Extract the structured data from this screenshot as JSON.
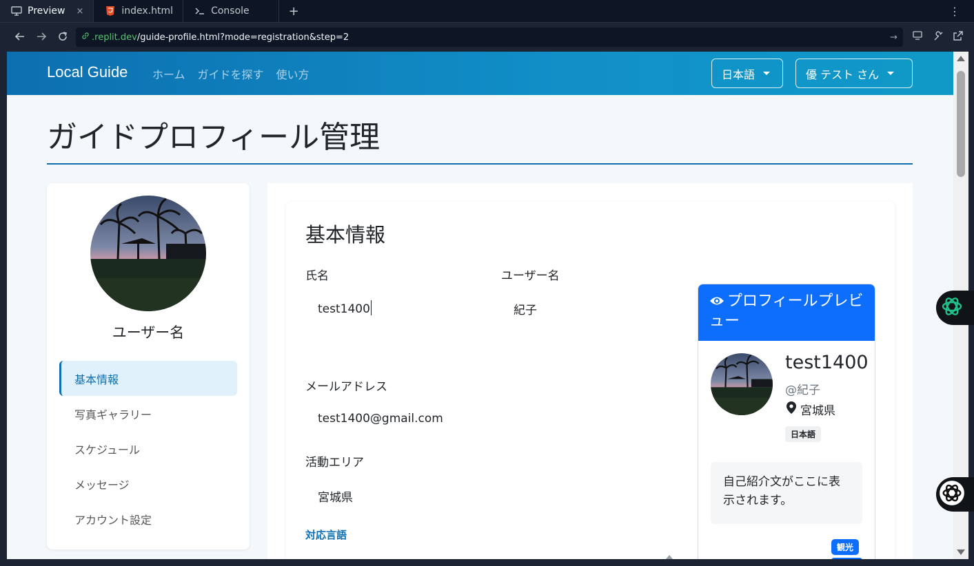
{
  "ide": {
    "tabs": [
      {
        "label": "Preview",
        "icon": "monitor-icon",
        "active": true
      },
      {
        "label": "index.html",
        "icon": "html5-icon",
        "active": false
      },
      {
        "label": "Console",
        "icon": "terminal-icon",
        "active": false
      }
    ],
    "close_glyph": "×",
    "add_tab_glyph": "+",
    "menu_glyph": "⋮"
  },
  "urlbar": {
    "host": ".replit.dev",
    "path": "/guide-profile.html?mode=registration&step=2"
  },
  "navbar": {
    "brand": "Local Guide",
    "links": [
      "ホーム",
      "ガイドを探す",
      "使い方"
    ],
    "language_button": "日本語",
    "user_button": "優 テスト さん"
  },
  "page": {
    "title": "ガイドプロフィール管理"
  },
  "sidebar": {
    "username": "ユーザー名",
    "items": [
      {
        "label": "基本情報",
        "active": true
      },
      {
        "label": "写真ギャラリー",
        "active": false
      },
      {
        "label": "スケジュール",
        "active": false
      },
      {
        "label": "メッセージ",
        "active": false
      },
      {
        "label": "アカウント設定",
        "active": false
      }
    ]
  },
  "form": {
    "section_title": "基本情報",
    "name_label": "氏名",
    "name_value": "test1400",
    "username_label": "ユーザー名",
    "username_value": "紀子",
    "email_label": "メールアドレス",
    "email_value": "test1400@gmail.com",
    "area_label": "活動エリア",
    "area_value": "宮城県",
    "languages_label": "対応言語"
  },
  "preview": {
    "header": "プロフィールプレビュー",
    "name": "test1400",
    "username": "@紀子",
    "location": "宮城県",
    "language_badge": "日本語",
    "bio": "自己紹介文がここに表示されます。",
    "tag": "観光"
  },
  "colors": {
    "navbar_accent": "#0d6fb0",
    "preview_header": "#0d6efd",
    "active_sidebar_bg": "#e1f1fb"
  }
}
